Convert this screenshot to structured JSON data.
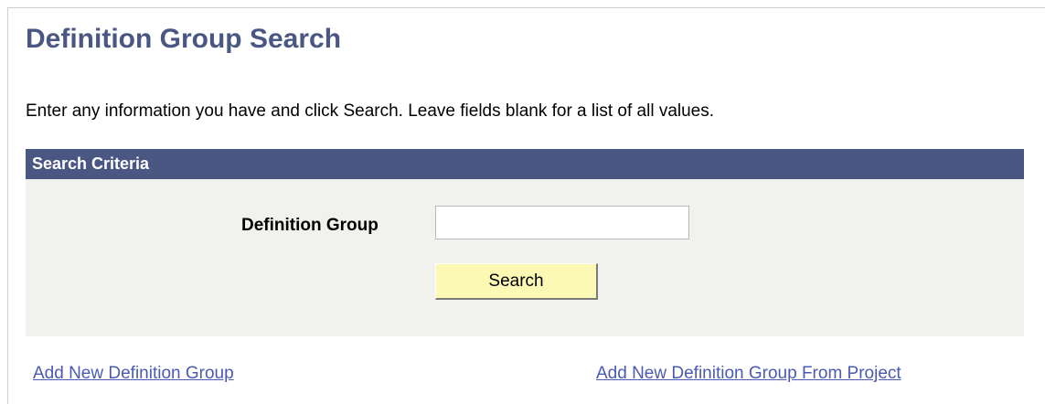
{
  "page": {
    "title": "Definition Group Search",
    "instructions": "Enter any information you have and click Search. Leave fields blank for a list of all values."
  },
  "search_criteria": {
    "header": "Search Criteria",
    "definition_group_label": "Definition Group",
    "definition_group_value": "",
    "search_button_label": "Search"
  },
  "links": {
    "add_new": "Add New Definition Group",
    "add_new_from_project": "Add New Definition Group From Project"
  },
  "colors": {
    "title": "#4a5783",
    "header_bar": "#4a5783",
    "panel_background": "#f1f2ed",
    "button_background": "#fbf9b3",
    "link": "#4a5ab0"
  }
}
